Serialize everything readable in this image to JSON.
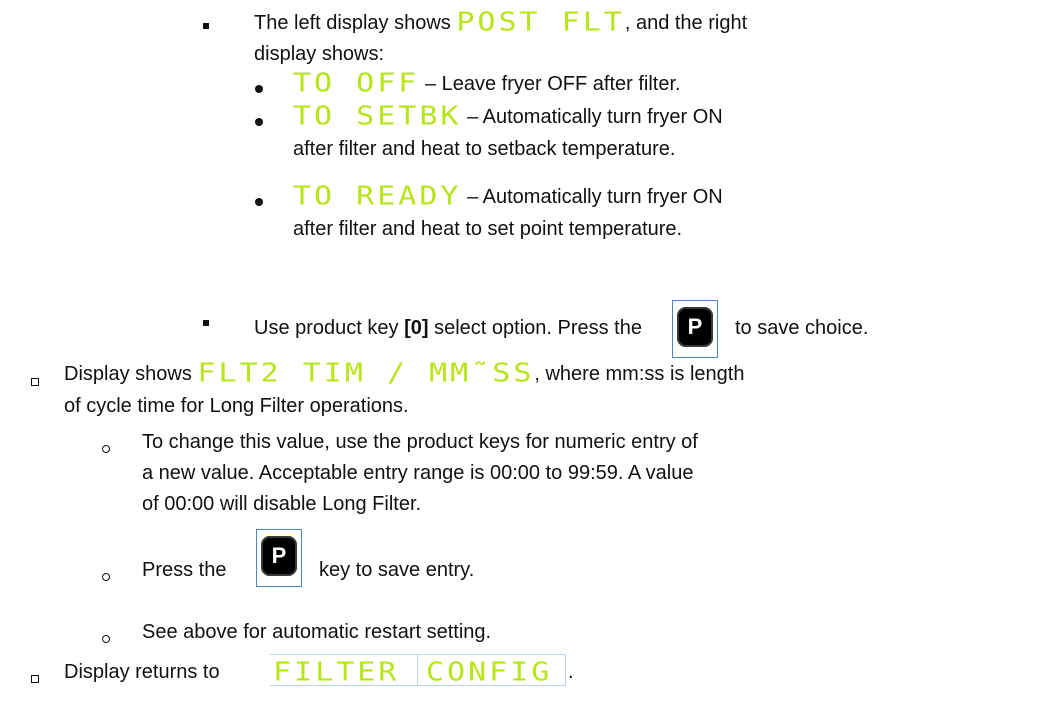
{
  "post_filter": {
    "intro_pre": "The left display shows",
    "left_display": "POST FLT",
    "intro_post": ", and the right",
    "intro_line2": "display shows:",
    "options": [
      {
        "display": "TO OFF",
        "desc_line1": "– Leave fryer OFF after filter.",
        "desc_line2": ""
      },
      {
        "display": "TO SETBK",
        "desc_line1": "– Automatically turn fryer ON",
        "desc_line2": "after filter and heat to setback temperature."
      },
      {
        "display": "TO READY",
        "desc_line1": "– Automatically turn fryer ON",
        "desc_line2": "after filter and heat to set point temperature."
      }
    ],
    "select_pre": "Use product key ",
    "select_key": "[0]",
    "select_mid": " select option.  Press the",
    "select_post": "to save choice."
  },
  "p_key_label": "P",
  "flt2": {
    "pre": "Display shows",
    "display": "FLT2 TIM / MM˜SS",
    "post": ", where mm:ss is length",
    "line2": "of cycle time for Long Filter operations.",
    "sub": {
      "change_line1": "To change this value, use the product keys for numeric entry of",
      "change_line2": "a new value. Acceptable entry range is 00:00 to 99:59. A value",
      "change_line3": "of 00:00 will disable Long Filter.",
      "press_pre": "Press the",
      "press_post": "key to save entry.",
      "see_above": "See above for automatic restart setting."
    }
  },
  "returns": {
    "pre": "Display returns to",
    "left_display": "FILTER",
    "right_display": "CONFIG",
    "post": "."
  },
  "colors": {
    "lcd_text": "#b6e51a",
    "key_frame": "#4a86c8",
    "display_box": "#b9d8ef"
  }
}
